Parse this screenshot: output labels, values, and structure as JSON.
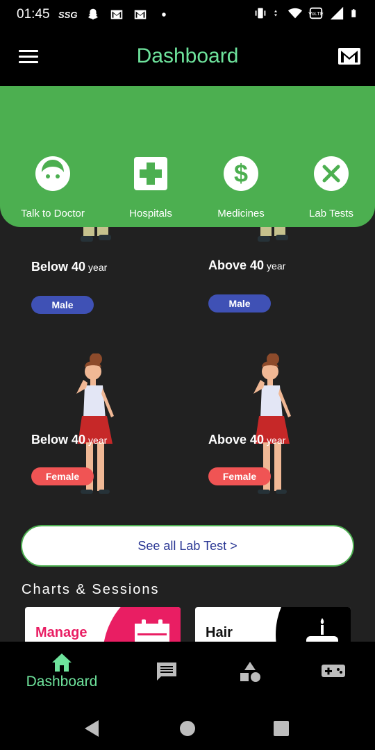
{
  "status_bar": {
    "time": "01:45",
    "carrier_badge": "SSG",
    "icons": [
      "snapchat-icon",
      "gmail-icon",
      "gmail-icon",
      "dot-icon",
      "vibrate-icon",
      "data-arrows-icon",
      "wifi-icon",
      "volte-icon",
      "signal-icon",
      "battery-icon"
    ]
  },
  "app_bar": {
    "title": "Dashboard",
    "accent_color": "#6ee39c"
  },
  "quick_actions": [
    {
      "label": "Talk to Doctor",
      "icon": "face-icon"
    },
    {
      "label": "Hospitals",
      "icon": "hospital-cross-icon"
    },
    {
      "label": "Medicines",
      "icon": "dollar-icon"
    },
    {
      "label": "Lab Tests",
      "icon": "close-circle-icon"
    }
  ],
  "lab_cards": [
    {
      "age": "Below 40",
      "unit": "year",
      "gender": "Male"
    },
    {
      "age": "Above 40",
      "unit": "year",
      "gender": "Male"
    },
    {
      "age": "Below 40",
      "unit": "year",
      "gender": "Female"
    },
    {
      "age": "Above 40",
      "unit": "year",
      "gender": "Female"
    }
  ],
  "see_all_button": "See all Lab Test >",
  "section_title": "Charts & Sessions",
  "session_cards": [
    {
      "label": "Manage",
      "label_color": "#e91e63",
      "icon": "calendar-icon"
    },
    {
      "label": "Hair",
      "label_color": "#111111",
      "icon": "cake-icon"
    }
  ],
  "bottom_nav": [
    {
      "label": "Dashboard",
      "icon": "home-icon",
      "active": true
    },
    {
      "label": "",
      "icon": "chat-icon",
      "active": false
    },
    {
      "label": "",
      "icon": "shapes-icon",
      "active": false
    },
    {
      "label": "",
      "icon": "gamepad-icon",
      "active": false
    }
  ],
  "colors": {
    "green_panel": "#4caf50",
    "background": "#212121",
    "male_pill": "#3f51b5",
    "female_pill": "#f05454",
    "link_text": "#283593"
  }
}
